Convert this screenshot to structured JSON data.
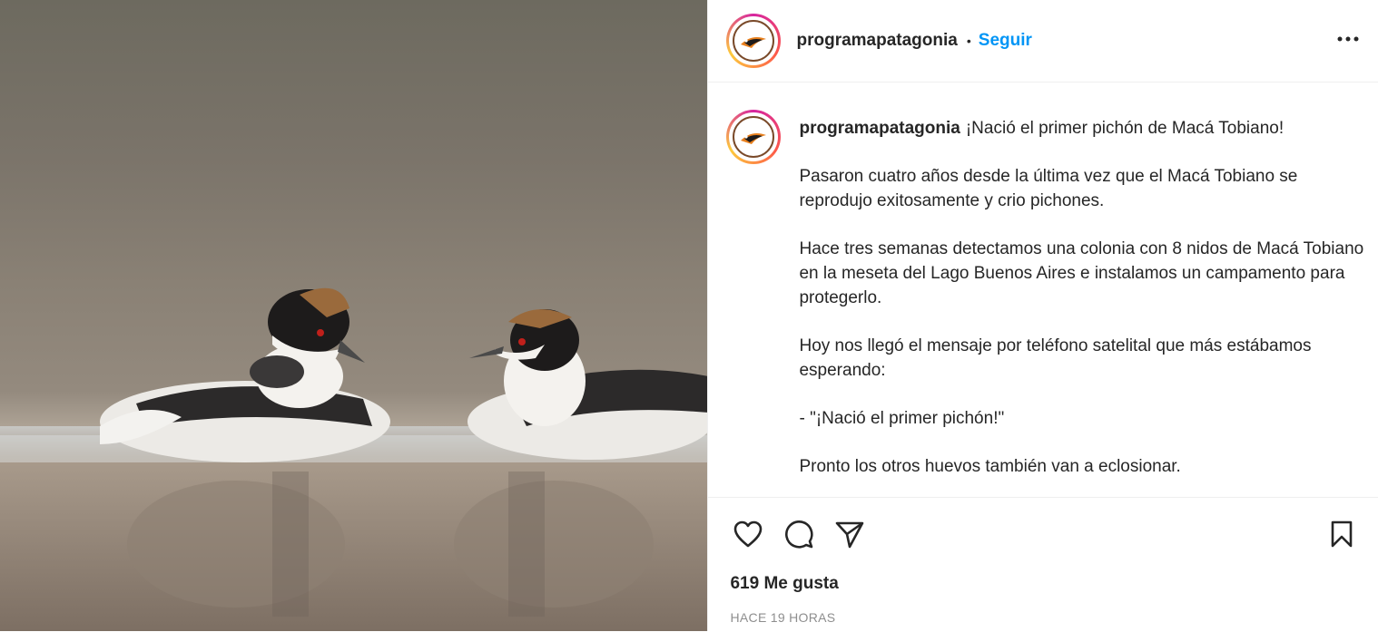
{
  "header": {
    "username": "programapatagonia",
    "separator": "•",
    "follow_label": "Seguir",
    "more_icon": "more-horizontal-icon"
  },
  "caption": {
    "username": "programapatagonia",
    "paragraphs": [
      "¡Nació el primer pichón de Macá Tobiano!",
      "Pasaron cuatro años desde la última vez que el Macá Tobiano se reprodujo exitosamente y crio pichones.",
      "Hace tres semanas detectamos una colonia con 8 nidos de Macá Tobiano en la meseta del Lago Buenos Aires e instalamos un campamento para protegerlo.",
      "Hoy nos llegó el mensaje por teléfono satelital que más estábamos esperando:",
      "- \"¡Nació el primer pichón!\"",
      "Pronto los otros huevos también van a eclosionar."
    ]
  },
  "actions": {
    "like_icon": "heart-icon",
    "comment_icon": "comment-icon",
    "share_icon": "send-icon",
    "save_icon": "bookmark-icon"
  },
  "stats": {
    "likes": "619 Me gusta",
    "time": "HACE 19 HORAS"
  },
  "colors": {
    "accent": "#0095f6",
    "text": "#262626",
    "muted": "#8e8e8e",
    "border": "#efefef"
  }
}
